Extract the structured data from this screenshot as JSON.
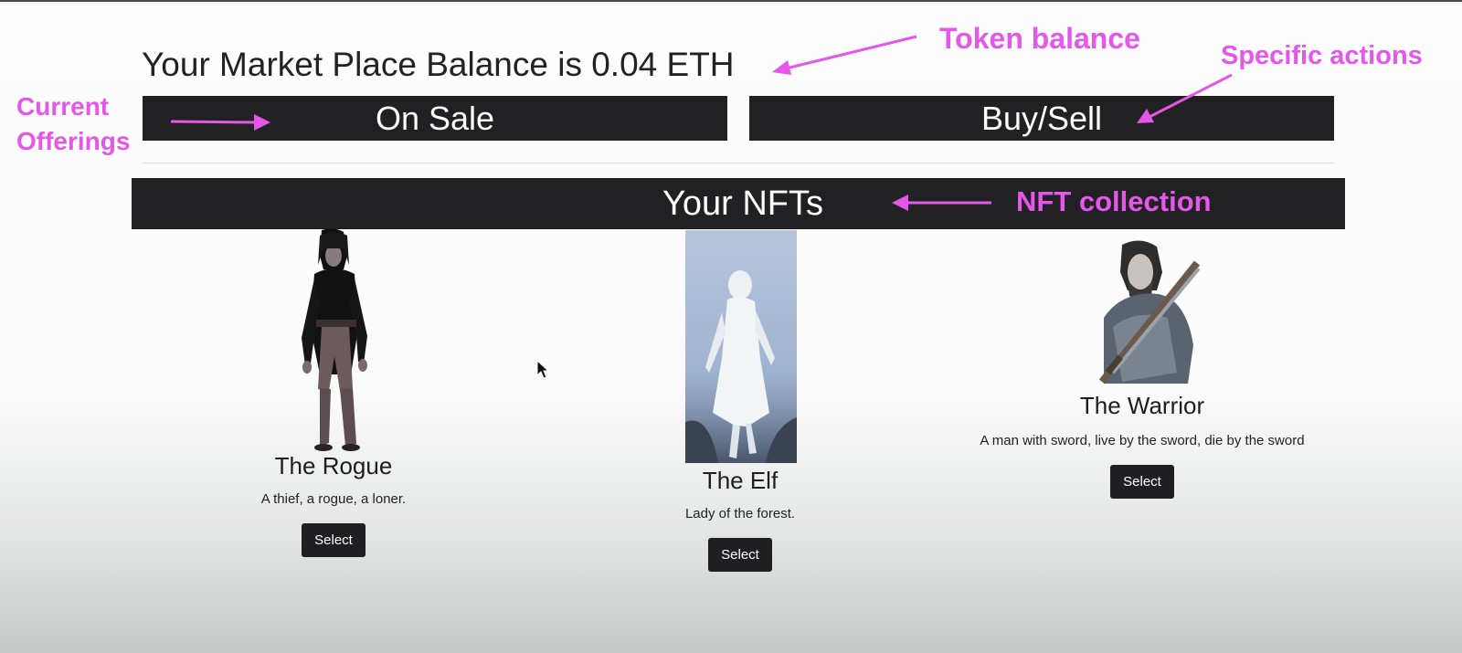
{
  "balance_text": "Your Market Place Balance is 0.04 ETH",
  "nav": {
    "on_sale_label": "On Sale",
    "buy_sell_label": "Buy/Sell"
  },
  "collection_title": "Your NFTs",
  "nfts": [
    {
      "name": "The Rogue",
      "description": "A thief, a rogue, a loner.",
      "button_label": "Select",
      "image": "rogue-image"
    },
    {
      "name": "The Elf",
      "description": "Lady of the forest.",
      "button_label": "Select",
      "image": "elf-image"
    },
    {
      "name": "The Warrior",
      "description": "A man with sword, live by the sword, die by the sword",
      "button_label": "Select",
      "image": "warrior-image"
    }
  ],
  "annotations": {
    "token_balance": "Token balance",
    "specific_actions": "Specific actions",
    "current_offerings_line1": "Current",
    "current_offerings_line2": "Offerings",
    "nft_collection": "NFT collection"
  },
  "colors": {
    "bar": "#212124",
    "annotation": "#e457e9"
  }
}
